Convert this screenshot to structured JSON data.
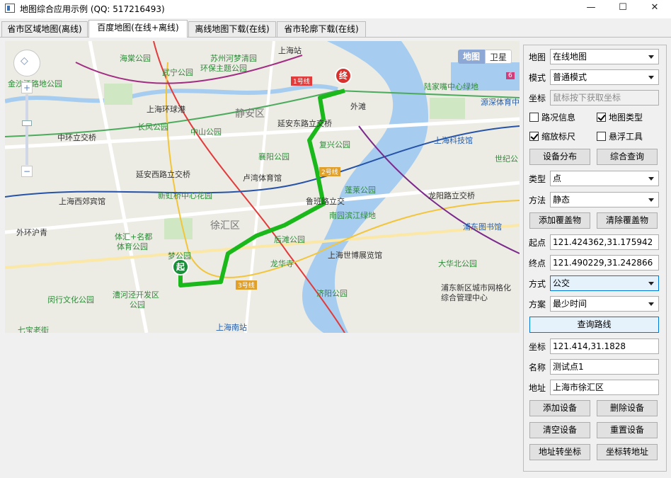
{
  "window": {
    "title": "地图综合应用示例 (QQ: 517216493)",
    "minimize": "—",
    "maximize": "☐",
    "close": "✕"
  },
  "tabs": [
    {
      "label": "省市区域地图(离线)"
    },
    {
      "label": "百度地图(在线+离线)"
    },
    {
      "label": "离线地图下载(在线)"
    },
    {
      "label": "省市轮廓下载(在线)"
    }
  ],
  "map": {
    "type_toggle": {
      "map": "地图",
      "satellite": "卫星"
    },
    "zoom_in": "+",
    "zoom_out": "−",
    "start_marker": "起",
    "end_marker": "终",
    "districts": [
      "静安区",
      "徐汇区"
    ],
    "parks": [
      "海棠公园",
      "苏州河梦清园",
      "环保主题公园",
      "武宁公园",
      "金沙江路地公园",
      "长风公园",
      "中山公园",
      "新虹桥中心花园",
      "襄阳公园",
      "复兴公园",
      "蓬莱公园",
      "南园滨江绿地",
      "后滩公园",
      "龙华寺",
      "济阳公园",
      "大华北公园",
      "体汇+名都",
      "体育公园",
      "梦公园",
      "漕河泾开发区",
      "公园",
      "闵行文化公园",
      "七宝老街",
      "陆家嘴中心绿地",
      "世纪公"
    ],
    "roads": [
      "中环立交桥",
      "延安西路立交桥",
      "外环沪青",
      "延安东路立交桥",
      "鲁班路立交",
      "龙阳路立交桥",
      "上海环球港"
    ],
    "pois": [
      "上海站",
      "外滩",
      "卢湾体育馆",
      "上海西郊宾馆",
      "上海世博展览馆",
      "浦东新区城市网格化",
      "综合管理中心",
      "浦东图书馆",
      "上海科技馆",
      "源深体育中",
      "上海南站"
    ],
    "metro_labels": [
      "1号线",
      "2号线",
      "3号线",
      "3号线",
      "6"
    ]
  },
  "form": {
    "map_label": "地图",
    "map_value": "在线地图",
    "mode_label": "模式",
    "mode_value": "普通模式",
    "coord_label": "坐标",
    "coord_placeholder": "鼠标按下获取坐标",
    "cb_traffic": "路况信息",
    "cb_traffic_checked": false,
    "cb_maptype": "地图类型",
    "cb_maptype_checked": true,
    "cb_scale": "缩放标尺",
    "cb_scale_checked": true,
    "cb_float": "悬浮工具",
    "cb_float_checked": false,
    "btn_device_dist": "设备分布",
    "btn_query": "综合查询",
    "type_label": "类型",
    "type_value": "点",
    "method_label": "方法",
    "method_value": "静态",
    "btn_add_overlay": "添加覆盖物",
    "btn_clear_overlay": "清除覆盖物",
    "start_label": "起点",
    "start_value": "121.424362,31.175942",
    "end_label": "终点",
    "end_value": "121.490229,31.242866",
    "way_label": "方式",
    "way_value": "公交",
    "plan_label": "方案",
    "plan_value": "最少时间",
    "btn_route": "查询路线",
    "dcoord_label": "坐标",
    "dcoord_value": "121.414,31.1828",
    "name_label": "名称",
    "name_value": "测试点1",
    "addr_label": "地址",
    "addr_value": "上海市徐汇区",
    "btn_add_device": "添加设备",
    "btn_del_device": "删除设备",
    "btn_clear_device": "清空设备",
    "btn_reset_device": "重置设备",
    "btn_addr2coord": "地址转坐标",
    "btn_coord2addr": "坐标转地址"
  }
}
